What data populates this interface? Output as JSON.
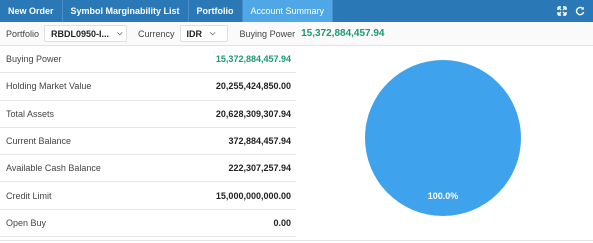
{
  "tabs": [
    {
      "label": "New Order",
      "active": false
    },
    {
      "label": "Symbol Marginability List",
      "active": false
    },
    {
      "label": "Portfolio",
      "active": false
    },
    {
      "label": "Account Summary",
      "active": true
    }
  ],
  "toolbar": {
    "portfolio_label": "Portfolio",
    "portfolio_value": "RBDL0950-I...",
    "currency_label": "Currency",
    "currency_value": "IDR",
    "buying_power_label": "Buying Power",
    "buying_power_value": "15,372,884,457.94"
  },
  "summary": {
    "rows": [
      {
        "label": "Buying Power",
        "value": "15,372,884,457.94",
        "highlight": true
      },
      {
        "label": "Holding Market Value",
        "value": "20,255,424,850.00"
      },
      {
        "label": "Total Assets",
        "value": "20,628,309,307.94"
      },
      {
        "label": "Current Balance",
        "value": "372,884,457.94"
      },
      {
        "label": "Available Cash Balance",
        "value": "222,307,257.94"
      },
      {
        "label": "Credit Limit",
        "value": "15,000,000,000.00"
      },
      {
        "label": "Open Buy",
        "value": "0.00"
      }
    ]
  },
  "chart_data": {
    "type": "pie",
    "slices": [
      {
        "label": "100.0%",
        "value": 100.0,
        "color": "#3ea2ec"
      }
    ]
  },
  "colors": {
    "tabbar": "#2a78b6",
    "tab_active": "#4fa8e5",
    "positive": "#1a9b6c",
    "pie": "#3ea2ec"
  },
  "icons": {
    "expand": "expand-icon",
    "refresh": "refresh-icon"
  }
}
